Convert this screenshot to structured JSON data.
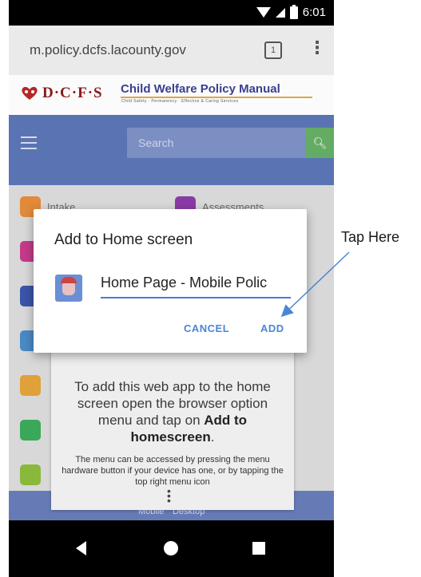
{
  "status_bar": {
    "time": "6:01"
  },
  "browser": {
    "url": "m.policy.dcfs.lacounty.gov",
    "tab_count": "1"
  },
  "site": {
    "logo_text": "D·C·F·S",
    "title": "Child Welfare Policy Manual",
    "tagline": "Child Safety · Permanency · Effective & Caring Services",
    "search_placeholder": "Search",
    "tiles": [
      "Intake",
      "Assessments"
    ]
  },
  "dialog": {
    "title": "Add to Home screen",
    "name_value": "Home Page - Mobile Polic",
    "cancel_label": "CANCEL",
    "add_label": "ADD"
  },
  "tooltip": {
    "main_prefix": "To add this web app to the home screen open the browser option menu and tap on ",
    "main_bold": "Add to homescreen",
    "main_suffix": ".",
    "small": "The menu can be accessed by pressing the menu hardware button if your device has one, or by tapping the top right menu icon"
  },
  "footer_links": {
    "mobile": "Mobile",
    "desktop": "Desktop"
  },
  "annotation": {
    "text": "Tap Here"
  },
  "colors": {
    "accent": "#4a86d6",
    "nav_blue": "#2c4fa3",
    "search_green": "#3a9a3a"
  }
}
